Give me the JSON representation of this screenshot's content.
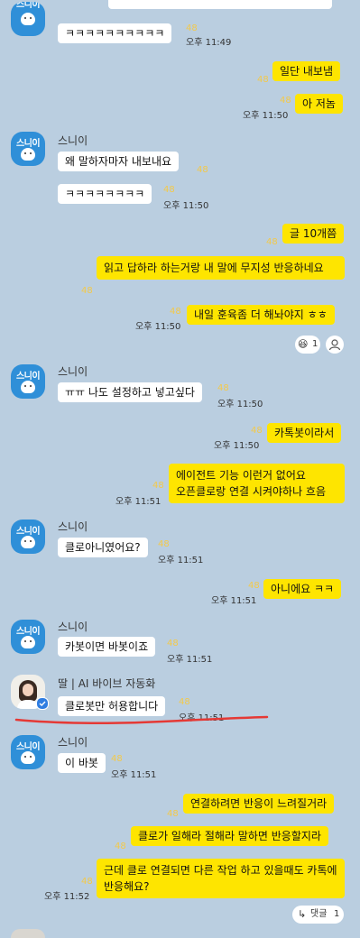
{
  "messages": {
    "m1": {
      "text": "ㅋㅋㅋㅋㅋㅋㅋㅋㅋㅋ",
      "unread": "48",
      "time": "오후 11:49"
    },
    "m2": {
      "text": "일단 내보냄",
      "unread": "48"
    },
    "m3": {
      "text": "아 저놈",
      "unread": "48",
      "time": "오후 11:50"
    },
    "m4": {
      "sender": "스니이",
      "text": "왜 말하자마자 내보내요",
      "unread": "48"
    },
    "m5": {
      "text": "ㅋㅋㅋㅋㅋㅋㅋㅋ",
      "unread": "48",
      "time": "오후 11:50"
    },
    "m6": {
      "text": "글 10개쯤",
      "unread": "48"
    },
    "m7": {
      "text": "읽고 답하라 하는거랑 내 말에 무지성 반응하네요",
      "unread": "48"
    },
    "m8": {
      "text": "내일 훈육좀 더 해놔야지 ㅎㅎ",
      "unread": "48",
      "time": "오후 11:50"
    },
    "m9": {
      "sender": "스니이",
      "text": "ㅠㅠ 나도 설정하고 넣고싶다",
      "unread": "48",
      "time": "오후 11:50"
    },
    "m10": {
      "text": "카톡봇이라서",
      "unread": "48",
      "time": "오후 11:50"
    },
    "m11": {
      "text": "에이전트 기능 이런거 없어요\n오픈클로랑 연결 시켜야하나 흐음",
      "unread": "48",
      "time": "오후 11:51"
    },
    "m12": {
      "sender": "스니이",
      "text": "클로아니였어요?",
      "unread": "48",
      "time": "오후 11:51"
    },
    "m13": {
      "text": "아니에요 ㅋㅋ",
      "unread": "48",
      "time": "오후 11:51"
    },
    "m14": {
      "sender": "스니이",
      "text": "카봇이면 바봇이죠",
      "unread": "48",
      "time": "오후 11:51"
    },
    "m15": {
      "sender": "딸 | AI 바이브 자동화",
      "text": "클로봇만 허용합니다",
      "unread": "48",
      "time": "오후 11:51"
    },
    "m16": {
      "sender": "스니이",
      "text": "이 바봇",
      "unread": "48",
      "time": "오후 11:51"
    },
    "m17": {
      "text": "연결하려면 반응이 느려질거라",
      "unread": "48"
    },
    "m18": {
      "text": "클로가 일해라 절해라 말하면 반응할지라",
      "unread": "48"
    },
    "m19": {
      "text": "근데 클로 연결되면 다른 작업 하고 있을때도 카톡에 반응해요?",
      "unread": "48",
      "time": "오후 11:52"
    }
  },
  "avatar_label": "스니이",
  "reactions": {
    "emoji": "😆",
    "count": "1"
  },
  "reply": {
    "label": "댓글",
    "count": "1"
  },
  "colors": {
    "background": "#bacee0",
    "my_bubble": "#fee500",
    "their_bubble": "#ffffff",
    "unread": "#f2c94c",
    "underline": "#e53935"
  }
}
